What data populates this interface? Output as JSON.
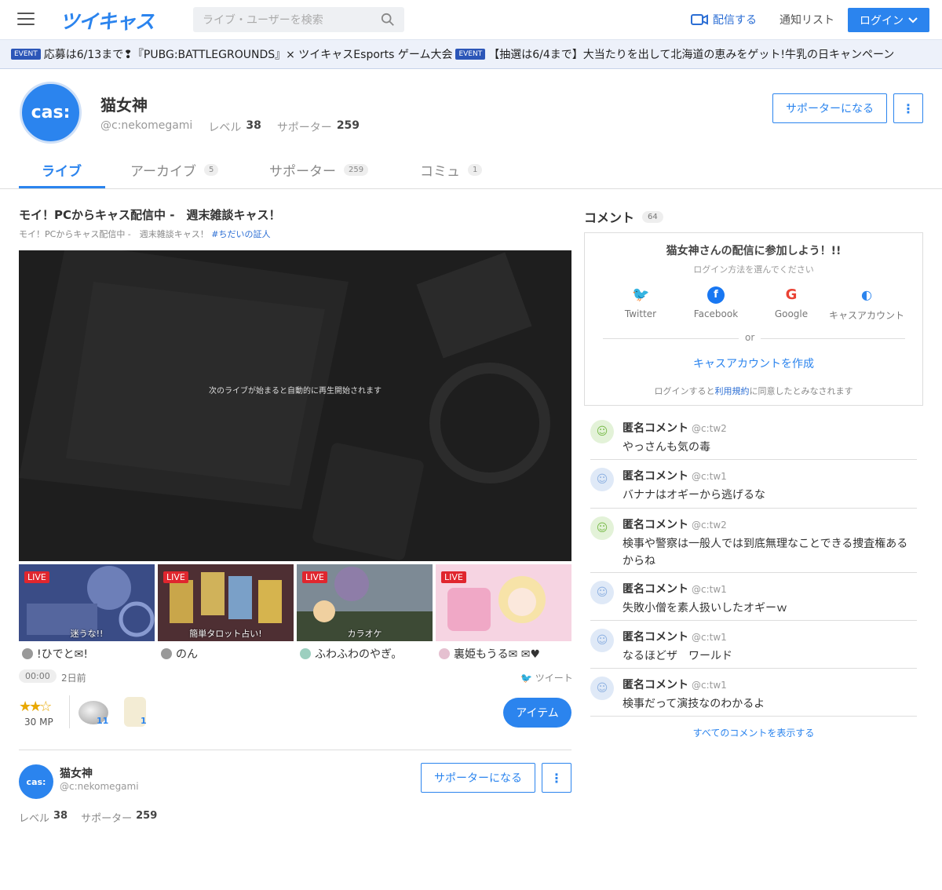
{
  "header": {
    "logo": "ツイキャス",
    "search_placeholder": "ライブ・ユーザーを検索",
    "stream_label": "配信する",
    "notice_label": "通知リスト",
    "login_label": "ログイン"
  },
  "events": [
    {
      "tag": "EVENT",
      "text": "応募は6/13まで❢『PUBG:BATTLEGROUNDS』× ツイキャスEsports ゲーム大会"
    },
    {
      "tag": "EVENT",
      "text": "【抽選は6/4まで】大当たりを出して北海道の恵みをゲット!牛乳の日キャンペーン"
    }
  ],
  "profile": {
    "avatar_text": "cas:",
    "name": "猫女神",
    "id": "@c:nekomegami",
    "level_label": "レベル",
    "level": "38",
    "supporter_label": "サポーター",
    "supporters": "259",
    "support_button": "サポーターになる",
    "more_icon": "⋮"
  },
  "tabs": [
    {
      "label": "ライブ",
      "count": ""
    },
    {
      "label": "アーカイブ",
      "count": "5"
    },
    {
      "label": "サポーター",
      "count": "259"
    },
    {
      "label": "コミュ",
      "count": "1"
    }
  ],
  "live": {
    "title": "モイ！PCからキャス配信中 -　週末雑談キャス！",
    "subtitle": "モイ！PCからキャス配信中 -　週末雑談キャス！",
    "hashtag": "#ちだいの証人",
    "player_message": "次のライブが始まると自動的に再生開始されます",
    "time": "00:00",
    "ago": "2日前",
    "tweet_label": "ツイート",
    "mp_label": "30 MP",
    "stars": "★★☆",
    "item_button": "アイテム",
    "item_counts": [
      "11",
      "1"
    ]
  },
  "thumbnails": [
    {
      "live": "LIVE",
      "label": "迷うな!!",
      "user": "!ひでと✉!",
      "color": "#2f3f6e"
    },
    {
      "live": "LIVE",
      "label": "簡単タロット占い!",
      "user": "のん",
      "color": "#5a3a2e"
    },
    {
      "live": "LIVE",
      "label": "カラオケ",
      "user": "ふわふわのやぎ。",
      "color": "#8a7a6a"
    },
    {
      "live": "LIVE",
      "label": "",
      "user": "裏姫もうる✉ ✉♥",
      "color": "#f3c6d8"
    }
  ],
  "footer_profile": {
    "avatar_text": "cas:",
    "name": "猫女神",
    "id": "@c:nekomegami",
    "level_label": "レベル",
    "level": "38",
    "supporter_label": "サポーター",
    "supporters": "259",
    "support_button": "サポーターになる"
  },
  "comments_panel": {
    "title": "コメント",
    "count": "64",
    "join_title": "猫女神さんの配信に参加しよう！!!",
    "join_sub": "ログイン方法を選んでください",
    "providers": [
      "Twitter",
      "Facebook",
      "Google",
      "キャスアカウント"
    ],
    "or": "or",
    "create_account": "キャスアカウントを作成",
    "agree_pre": "ログインすると",
    "agree_link": "利用規約",
    "agree_post": "に同意したとみなされます",
    "show_all": "すべてのコメントを表示する"
  },
  "comments": [
    {
      "name": "匿名コメント",
      "id": "@c:tw2",
      "text": "やっさんも気の毒",
      "avatar": "green"
    },
    {
      "name": "匿名コメント",
      "id": "@c:tw1",
      "text": "バナナはオギーから逃げるな",
      "avatar": "blue"
    },
    {
      "name": "匿名コメント",
      "id": "@c:tw2",
      "text": "検事や警察は一般人では到底無理なことできる捜査権あるからね",
      "avatar": "green"
    },
    {
      "name": "匿名コメント",
      "id": "@c:tw1",
      "text": "失敗小僧を素人扱いしたオギーｗ",
      "avatar": "blue"
    },
    {
      "name": "匿名コメント",
      "id": "@c:tw1",
      "text": "なるほどザ　ワールド",
      "avatar": "blue"
    },
    {
      "name": "匿名コメント",
      "id": "@c:tw1",
      "text": "検事だって演技なのわかるよ",
      "avatar": "blue"
    }
  ]
}
